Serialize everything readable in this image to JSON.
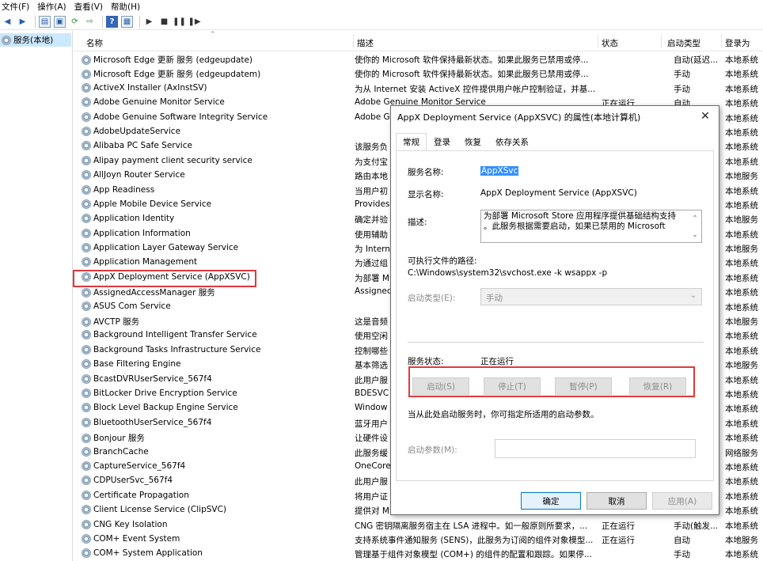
{
  "menu": [
    "文件(F)",
    "操作(A)",
    "查看(V)",
    "帮助(H)"
  ],
  "tree": {
    "item": "服务(本地)"
  },
  "columns": {
    "name": "名称",
    "desc": "描述",
    "status": "状态",
    "startup": "启动类型",
    "logon": "登录为"
  },
  "rows": [
    {
      "name": "Microsoft Edge 更新 服务 (edgeupdate)",
      "desc": "使你的 Microsoft 软件保持最新状态。如果此服务已禁用或停...",
      "status": "",
      "startup": "自动(延迟...",
      "logon": "本地系统"
    },
    {
      "name": "Microsoft Edge 更新 服务 (edgeupdatem)",
      "desc": "使你的 Microsoft 软件保持最新状态。如果此服务已禁用或停...",
      "status": "",
      "startup": "手动",
      "logon": "本地系统"
    },
    {
      "name": "ActiveX Installer (AxInstSV)",
      "desc": "为从 Internet 安装 ActiveX 控件提供用户帐户控制验证，并基...",
      "status": "",
      "startup": "手动",
      "logon": "本地系统"
    },
    {
      "name": "Adobe Genuine Monitor Service",
      "desc": "Adobe Genuine Monitor Service",
      "status": "正在运行",
      "startup": "自动",
      "logon": "本地系统"
    },
    {
      "name": "Adobe Genuine Software Integrity Service",
      "desc": "Adobe G",
      "status": "",
      "startup": "",
      "logon": "本地系统"
    },
    {
      "name": "AdobeUpdateService",
      "desc": "",
      "status": "",
      "startup": "",
      "logon": "本地系统"
    },
    {
      "name": "Alibaba PC Safe Service",
      "desc": "该服务负",
      "status": "",
      "startup": "",
      "logon": "本地系统"
    },
    {
      "name": "Alipay payment client security service",
      "desc": "为支付宝",
      "status": "",
      "startup": "",
      "logon": "本地系统"
    },
    {
      "name": "AllJoyn Router Service",
      "desc": "路由本地",
      "status": "",
      "startup": "",
      "logon": "本地服务"
    },
    {
      "name": "App Readiness",
      "desc": "当用户初",
      "status": "",
      "startup": "",
      "logon": "本地系统"
    },
    {
      "name": "Apple Mobile Device Service",
      "desc": "Provides",
      "status": "",
      "startup": "",
      "logon": "本地系统"
    },
    {
      "name": "Application Identity",
      "desc": "确定并验",
      "status": "",
      "startup": "",
      "logon": "本地服务"
    },
    {
      "name": "Application Information",
      "desc": "使用辅助",
      "status": "",
      "startup": "",
      "logon": "本地系统"
    },
    {
      "name": "Application Layer Gateway Service",
      "desc": "为 Intern",
      "status": "",
      "startup": "",
      "logon": "本地服务"
    },
    {
      "name": "Application Management",
      "desc": "为通过组",
      "status": "",
      "startup": "",
      "logon": "本地系统"
    },
    {
      "name": "AppX Deployment Service (AppXSVC)",
      "desc": "为部署 M",
      "status": "",
      "startup": "",
      "logon": "本地系统"
    },
    {
      "name": "AssignedAccessManager 服务",
      "desc": "Assigned",
      "status": "",
      "startup": "",
      "logon": "本地系统"
    },
    {
      "name": "ASUS Com Service",
      "desc": "",
      "status": "",
      "startup": "",
      "logon": "本地系统"
    },
    {
      "name": "AVCTP 服务",
      "desc": "这是音频",
      "status": "",
      "startup": "",
      "logon": "本地服务"
    },
    {
      "name": "Background Intelligent Transfer Service",
      "desc": "使用空闲",
      "status": "",
      "startup": "",
      "logon": "本地系统"
    },
    {
      "name": "Background Tasks Infrastructure Service",
      "desc": "控制哪些",
      "status": "",
      "startup": "",
      "logon": "本地系统"
    },
    {
      "name": "Base Filtering Engine",
      "desc": "基本筛选",
      "status": "",
      "startup": "",
      "logon": "本地服务"
    },
    {
      "name": "BcastDVRUserService_567f4",
      "desc": "此用户服",
      "status": "",
      "startup": "",
      "logon": "本地系统"
    },
    {
      "name": "BitLocker Drive Encryption Service",
      "desc": "BDESVC",
      "status": "",
      "startup": "",
      "logon": "本地系统"
    },
    {
      "name": "Block Level Backup Engine Service",
      "desc": "Window",
      "status": "",
      "startup": "",
      "logon": "本地系统"
    },
    {
      "name": "BluetoothUserService_567f4",
      "desc": "蓝牙用户",
      "status": "",
      "startup": "",
      "logon": "本地系统"
    },
    {
      "name": "Bonjour 服务",
      "desc": "让硬件设",
      "status": "",
      "startup": "",
      "logon": "本地系统"
    },
    {
      "name": "BranchCache",
      "desc": "此服务缓",
      "status": "",
      "startup": "",
      "logon": "网络服务"
    },
    {
      "name": "CaptureService_567f4",
      "desc": "OneCore",
      "status": "",
      "startup": "",
      "logon": "本地系统"
    },
    {
      "name": "CDPUserSvc_567f4",
      "desc": "此用户服",
      "status": "",
      "startup": "",
      "logon": "本地系统"
    },
    {
      "name": "Certificate Propagation",
      "desc": "将用户证",
      "status": "",
      "startup": "",
      "logon": "本地系统"
    },
    {
      "name": "Client License Service (ClipSVC)",
      "desc": "提供对 M",
      "status": "",
      "startup": "",
      "logon": "本地系统"
    },
    {
      "name": "CNG Key Isolation",
      "desc": "CNG 密钥隔离服务宿主在 LSA 进程中。如一般原则所要求，...",
      "status": "正在运行",
      "startup": "手动(触发...",
      "logon": "本地系统"
    },
    {
      "name": "COM+ Event System",
      "desc": "支持系统事件通知服务 (SENS)，此服务为订阅的组件对象模型...",
      "status": "正在运行",
      "startup": "自动",
      "logon": "本地服务"
    },
    {
      "name": "COM+ System Application",
      "desc": "管理基于组件对象模型 (COM+) 的组件的配置和跟踪。如果停...",
      "status": "",
      "startup": "手动",
      "logon": "本地系统"
    }
  ],
  "dialog": {
    "title": "AppX Deployment Service (AppXSVC) 的属性(本地计算机)",
    "tabs": [
      "常规",
      "登录",
      "恢复",
      "依存关系"
    ],
    "service_name_label": "服务名称:",
    "service_name": "AppXSvc",
    "display_name_label": "显示名称:",
    "display_name": "AppX Deployment Service (AppXSVC)",
    "desc_label": "描述:",
    "desc_line1": "为部署 Microsoft Store 应用程序提供基础结构支持",
    "desc_line2": "。此服务根据需要启动，如果已禁用的 Microsoft",
    "exe_label": "可执行文件的路径:",
    "exe_path": "C:\\Windows\\system32\\svchost.exe -k wsappx -p",
    "startup_label": "启动类型(E):",
    "startup_value": "手动",
    "status_label": "服务状态:",
    "status_value": "正在运行",
    "btn_start": "启动(S)",
    "btn_stop": "停止(T)",
    "btn_pause": "暂停(P)",
    "btn_resume": "恢复(R)",
    "hint": "当从此处启动服务时，你可指定所适用的启动参数。",
    "param_label": "启动参数(M):",
    "ok": "确定",
    "cancel": "取消",
    "apply": "应用(A)"
  },
  "colors": {
    "highlight_red": "#e0393c",
    "selection_blue": "#3390ff",
    "tree_selected": "#cce8ff"
  }
}
